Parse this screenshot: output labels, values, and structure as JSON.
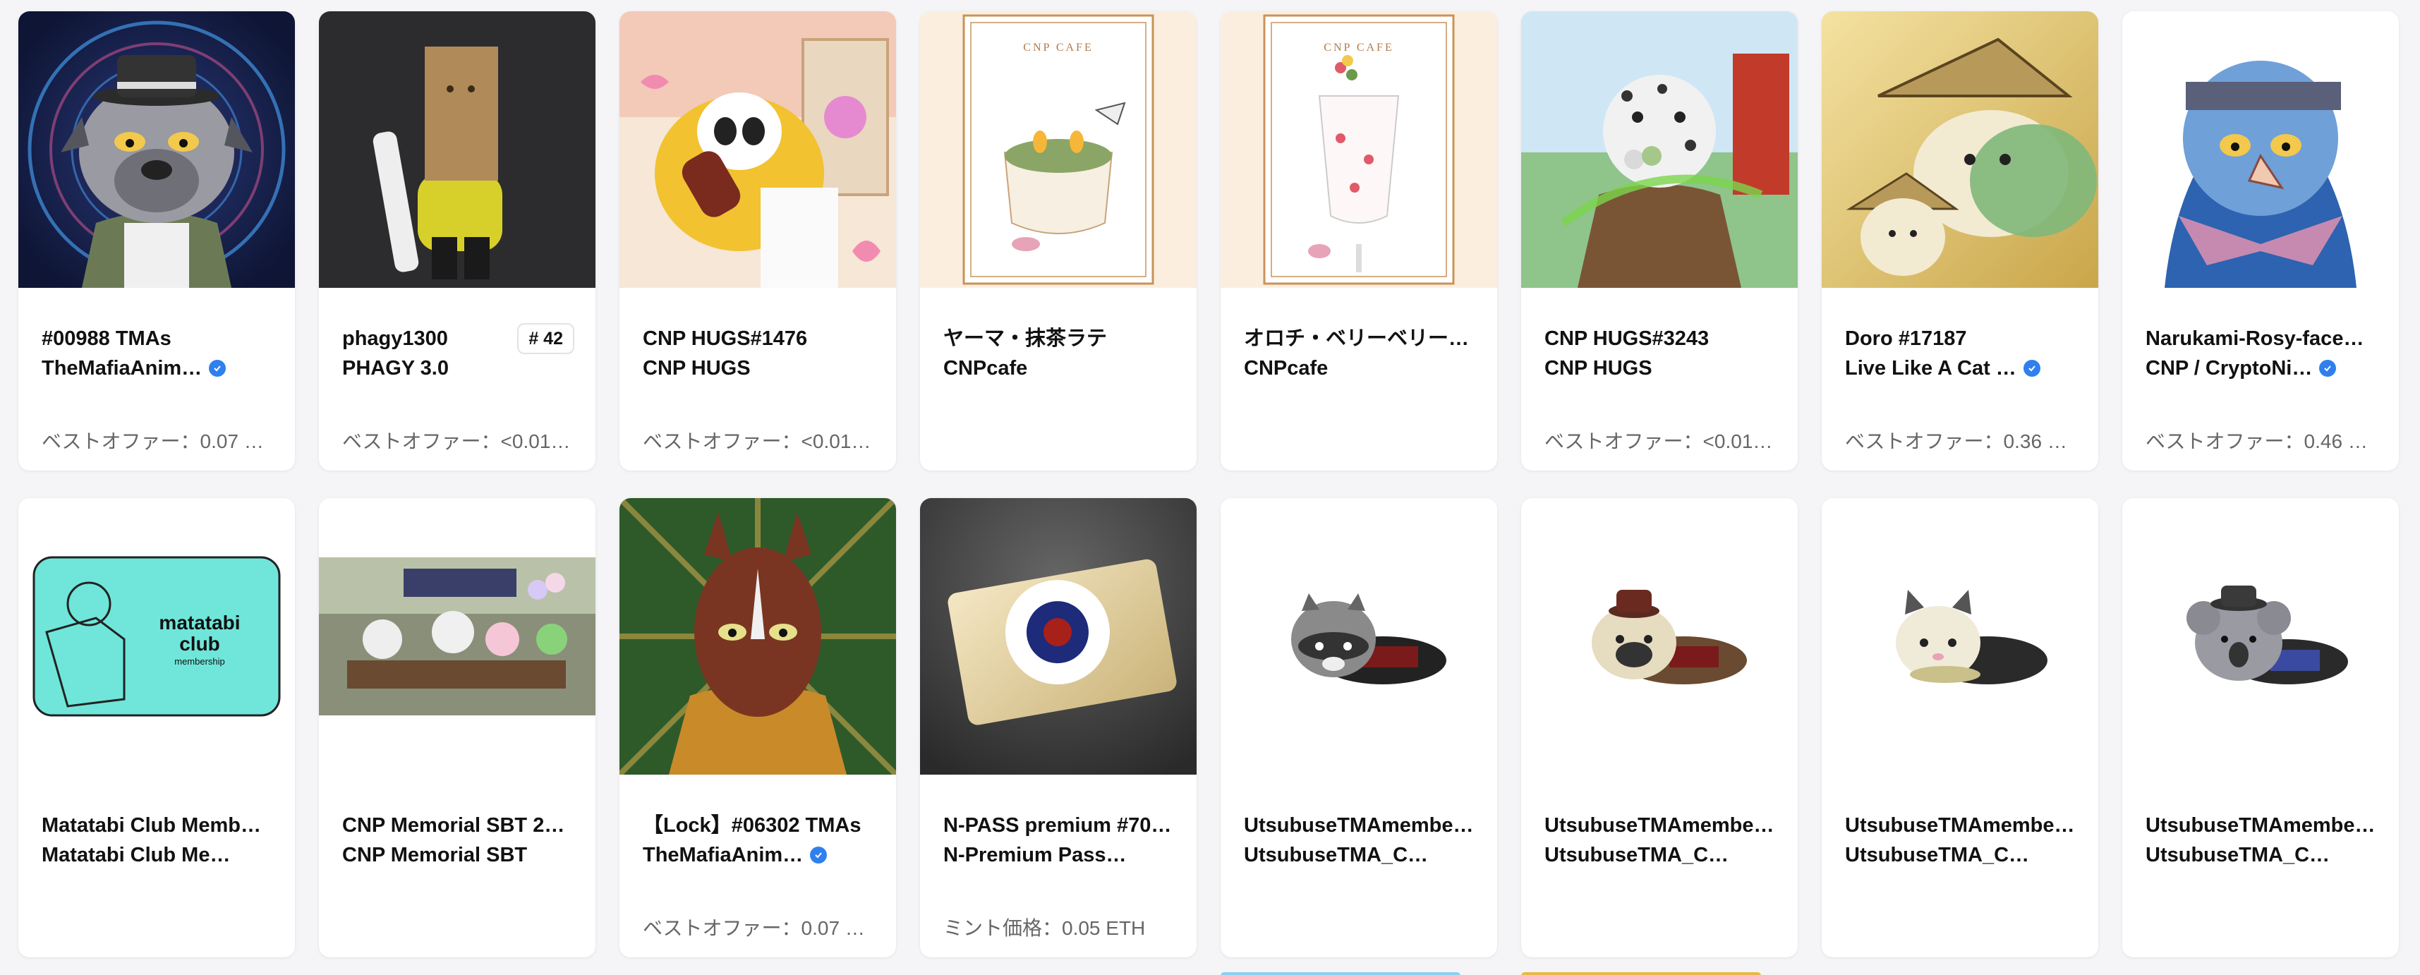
{
  "cards": [
    {
      "title": "#00988 TMAs",
      "collection": "TheMafiaAnim…",
      "verified": true,
      "price": "ベストオファー：0.07 …",
      "image": "pug-mafia-avatar"
    },
    {
      "title": "phagy1300",
      "collection": "PHAGY 3.0",
      "verified": false,
      "badge": "# 42",
      "price": "ベストオファー：<0.01 …",
      "image": "box-head-figure"
    },
    {
      "title": "CNP HUGS#1476",
      "collection": "CNP HUGS",
      "verified": false,
      "price": "ベストオファー：<0.01 …",
      "image": "panda-hug-illustration"
    },
    {
      "title": "ヤーマ・抹茶ラテ",
      "collection": "CNPcafe",
      "verified": false,
      "price": "",
      "image": "matcha-latte-card",
      "card_label": "CNP CAFE"
    },
    {
      "title": "オロチ・ベリーベリー…",
      "collection": "CNPcafe",
      "verified": false,
      "price": "",
      "image": "berry-parfait-card",
      "card_label": "CNP CAFE"
    },
    {
      "title": "CNP HUGS#3243",
      "collection": "CNP HUGS",
      "verified": false,
      "price": "ベストオファー：<0.01 …",
      "image": "leopard-ninja-illustration"
    },
    {
      "title": "Doro #17187",
      "collection": "Live Like A Cat …",
      "verified": true,
      "price": "ベストオファー：0.36 …",
      "image": "cats-straw-hat"
    },
    {
      "title": "Narukami-Rosy-faced …",
      "collection": "CNP / CryptoNi…",
      "verified": true,
      "price": "ベストオファー：0.46 …",
      "image": "ninja-parrot"
    },
    {
      "title": "Matatabi Club Membe…",
      "collection": "Matatabi Club Me…",
      "verified": false,
      "price": "",
      "image": "matatabi-club-logo",
      "logo_text": "matatabi",
      "logo_text2": "club",
      "logo_sub": "membership"
    },
    {
      "title": "CNP Memorial SBT 20…",
      "collection": "CNP Memorial SBT",
      "verified": false,
      "price": "",
      "image": "memorial-party-photo"
    },
    {
      "title": "【Lock】#06302 TMAs",
      "collection": "TheMafiaAnim…",
      "verified": true,
      "price": "ベストオファー：0.07 …",
      "image": "horse-hoodie-avatar"
    },
    {
      "title": "N-PASS premium #70…",
      "collection": "N-Premium Passp…",
      "verified": false,
      "price": "ミント価格：0.05 ETH",
      "image": "npass-card"
    },
    {
      "title": "UtsubuseTMAmember…",
      "collection": "UtsubuseTMA_Co…",
      "verified": false,
      "price": "",
      "image": "raccoon-lying"
    },
    {
      "title": "UtsubuseTMAmember…",
      "collection": "UtsubuseTMA_Co…",
      "verified": false,
      "price": "",
      "image": "pug-lying"
    },
    {
      "title": "UtsubuseTMAmember…",
      "collection": "UtsubuseTMA_Co…",
      "verified": false,
      "price": "",
      "image": "cat-lying"
    },
    {
      "title": "UtsubuseTMAmember…",
      "collection": "UtsubuseTMA_Co…",
      "verified": false,
      "price": "",
      "image": "koala-lying"
    }
  ],
  "colors": {
    "verified": "#2f80ed",
    "page_bg": "#f5f5f7",
    "card_bg": "#ffffff"
  }
}
